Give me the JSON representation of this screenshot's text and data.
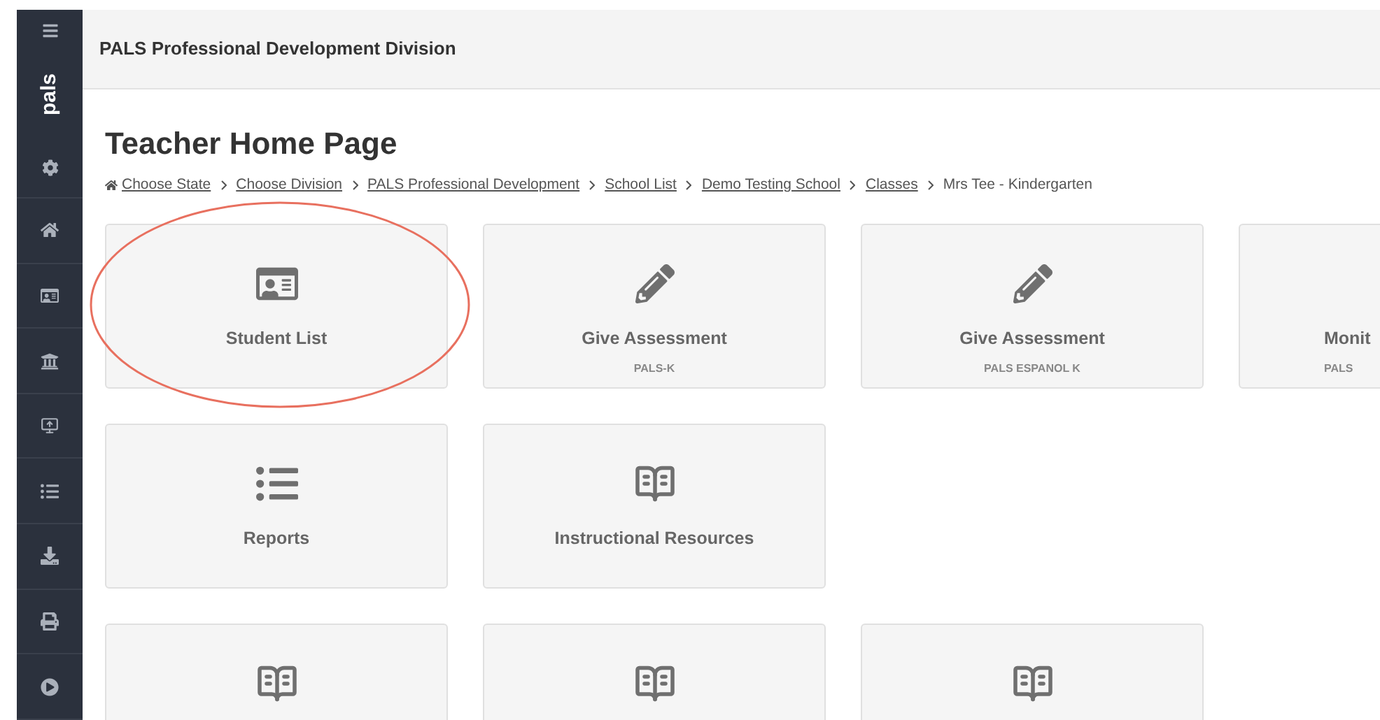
{
  "sidebar": {
    "logo": "pals"
  },
  "header": {
    "title": "PALS Professional Development Division"
  },
  "page_title": "Teacher Home Page",
  "breadcrumb": [
    {
      "label": "Choose State",
      "kind": "link"
    },
    {
      "label": "Choose Division",
      "kind": "link"
    },
    {
      "label": "PALS Professional Development",
      "kind": "link"
    },
    {
      "label": "School List",
      "kind": "link"
    },
    {
      "label": "Demo Testing School",
      "kind": "link"
    },
    {
      "label": "Classes",
      "kind": "link"
    },
    {
      "label": "Mrs Tee - Kindergarten",
      "kind": "current"
    }
  ],
  "card_rows": [
    [
      {
        "kind": "students",
        "title": "Student List",
        "highlighted": true
      },
      {
        "kind": "assessment",
        "title": "Give Assessment",
        "subtitle": "PALS-K",
        "highlighted": false
      },
      {
        "kind": "assessment",
        "title": "Give Assessment",
        "subtitle": "PALS ESPANOL K",
        "highlighted": false
      },
      {
        "kind": "monitor",
        "title": "Monit",
        "subtitle": "PALS",
        "highlighted": false
      }
    ],
    [
      {
        "kind": "reports",
        "title": "Reports",
        "highlighted": false
      },
      {
        "kind": "resources",
        "title": "Instructional Resources",
        "highlighted": false
      }
    ],
    [
      {
        "kind": "resources",
        "highlighted": false
      },
      {
        "kind": "resources",
        "highlighted": false
      },
      {
        "kind": "resources",
        "highlighted": false
      }
    ]
  ]
}
